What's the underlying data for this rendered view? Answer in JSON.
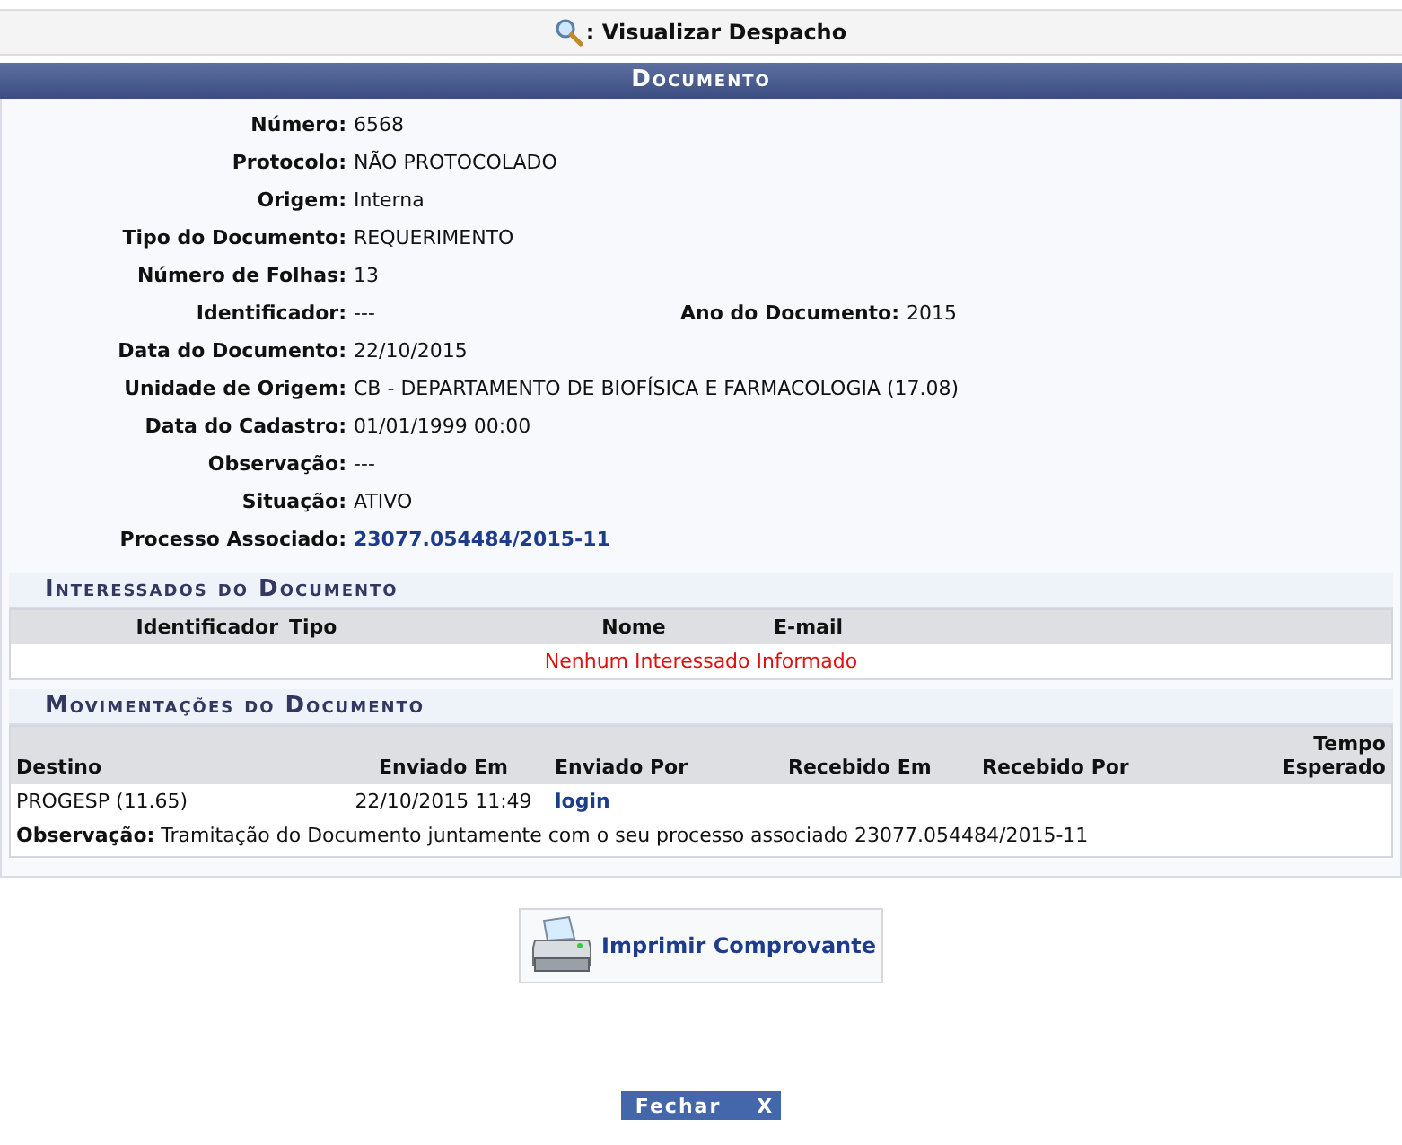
{
  "page_title": ": Visualizar Despacho",
  "document": {
    "title": "Documento",
    "rows": [
      [
        {
          "label": "Número:",
          "value": "6568",
          "kind": "text"
        }
      ],
      [
        {
          "label": "Protocolo:",
          "value": "NÃO PROTOCOLADO",
          "kind": "text"
        }
      ],
      [
        {
          "label": "Origem:",
          "value": "Interna",
          "kind": "text"
        }
      ],
      [
        {
          "label": "Tipo do Documento:",
          "value": "REQUERIMENTO",
          "kind": "text"
        }
      ],
      [
        {
          "label": "Número de Folhas:",
          "value": "13",
          "kind": "text"
        }
      ],
      [
        {
          "label": "Identificador:",
          "value": "---",
          "kind": "text"
        },
        {
          "label": "Ano do Documento:",
          "value": "2015",
          "kind": "text"
        }
      ],
      [
        {
          "label": "Data do Documento:",
          "value": "22/10/2015",
          "kind": "text"
        }
      ],
      [
        {
          "label": "Unidade de Origem:",
          "value": "CB - DEPARTAMENTO DE BIOFÍSICA E FARMACOLOGIA (17.08)",
          "kind": "text"
        }
      ],
      [
        {
          "label": "Data do Cadastro:",
          "value": "01/01/1999 00:00",
          "kind": "text"
        }
      ],
      [
        {
          "label": "Observação:",
          "value": "---",
          "kind": "text"
        }
      ],
      [
        {
          "label": "Situação:",
          "value": "ATIVO",
          "kind": "text"
        }
      ],
      [
        {
          "label": "Processo Associado:",
          "value": "23077.054484/2015-11",
          "kind": "link"
        }
      ]
    ]
  },
  "interessados": {
    "title": "Interessados do Documento",
    "columns": [
      "Identificador",
      "Tipo",
      "Nome",
      "E-mail"
    ],
    "empty_message": "Nenhum Interessado Informado"
  },
  "movimentacoes": {
    "title": "Movimentações do Documento",
    "columns": [
      "Destino",
      "Enviado Em",
      "Enviado Por",
      "Recebido Em",
      "Recebido Por",
      "Tempo Esperado"
    ],
    "rows": [
      {
        "destino": "PROGESP (11.65)",
        "enviado_em": "22/10/2015 11:49",
        "enviado_por": "login",
        "observacao_label": "Observação:",
        "observacao": "Tramitação do Documento juntamente com o seu processo associado 23077.054484/2015-11"
      }
    ]
  },
  "print_button": "Imprimir Comprovante",
  "close_button": {
    "label": "Fechar",
    "glyph": "X"
  }
}
